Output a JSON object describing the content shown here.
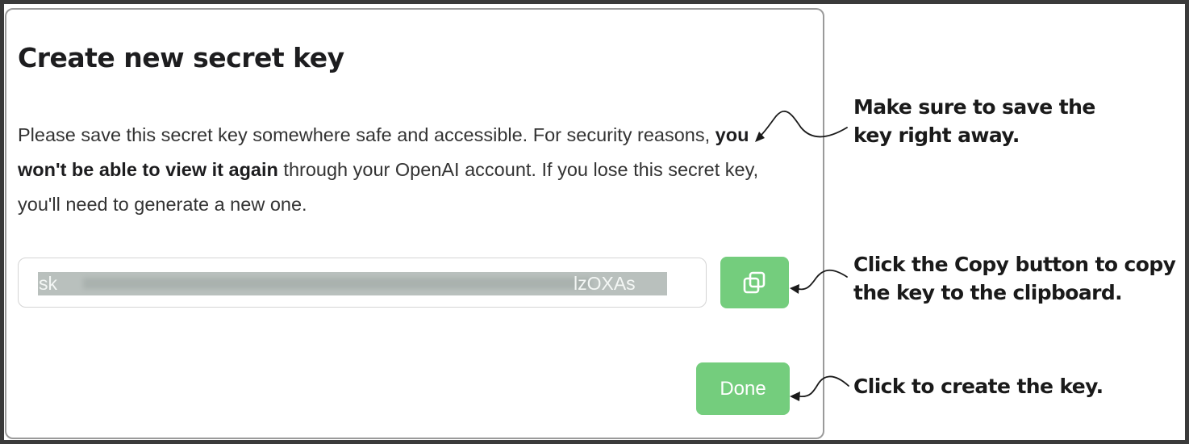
{
  "dialog": {
    "title": "Create new secret key",
    "description": {
      "before": "Please save this secret key somewhere safe and accessible. For security reasons, ",
      "bold": "you won't be able to view it again",
      "after": " through your OpenAI account. If you lose this secret key, you'll need to generate a new one."
    },
    "key_field": {
      "visible_prefix": "sk",
      "visible_suffix": "lzOXAs",
      "masked": true
    },
    "copy_button": {
      "icon": "copy-icon"
    },
    "done_button": {
      "label": "Done"
    }
  },
  "callouts": {
    "save_key": [
      "Make sure to save the",
      "key right away."
    ],
    "copy": [
      "Click the Copy button to copy",
      "the key to the clipboard."
    ],
    "create": [
      "Click to create the key."
    ]
  },
  "colors": {
    "accent_green": "#74cd7d",
    "frame": "#3a3a3a",
    "key_highlight": "#b9c0bd"
  }
}
